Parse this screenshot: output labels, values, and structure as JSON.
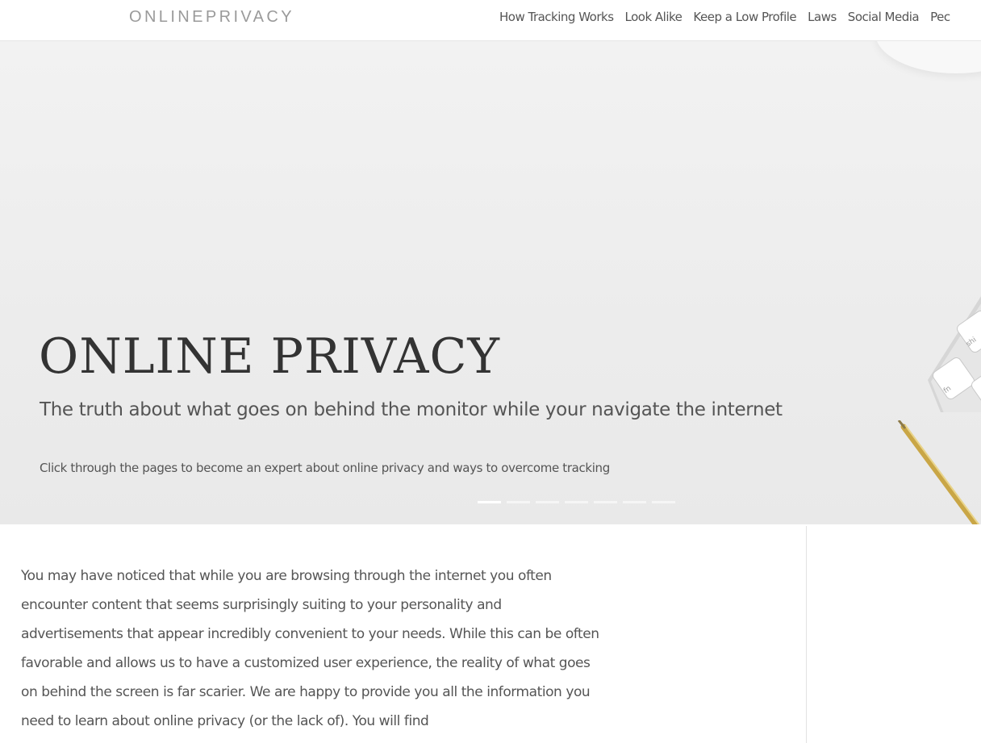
{
  "brand": {
    "logo": "ONLINEPRIVACY"
  },
  "nav": {
    "items": [
      {
        "label": "How Tracking Works"
      },
      {
        "label": "Look Alike"
      },
      {
        "label": "Keep a Low Profile"
      },
      {
        "label": "Laws"
      },
      {
        "label": "Social Media"
      },
      {
        "label": "Pec"
      }
    ]
  },
  "hero": {
    "title": "ONLINE PRIVACY",
    "subtitle": "The truth about what goes on behind the monitor while your navigate the internet",
    "cta": "Click through the pages to become an expert about online privacy and ways to overcome tracking",
    "slides": {
      "count": 7,
      "active": 1
    },
    "keyboard_keys": [
      "shi",
      "fn"
    ]
  },
  "main": {
    "intro": "You may have noticed that while you are browsing through the internet you often encounter content that seems surprisingly suiting to your personality and advertisements that appear incredibly convenient to your needs. While this can be often favorable and allows us to have a customized user experience, the reality of what goes on behind the screen is far scarier. We are happy to provide you all the information you need to learn about online privacy (or the lack of). You will find"
  },
  "colors": {
    "brand_text": "#9a9a9a",
    "nav_text": "#555555",
    "hero_title": "#333333",
    "body_text": "#555555",
    "pen_gold": "#c9a646"
  }
}
